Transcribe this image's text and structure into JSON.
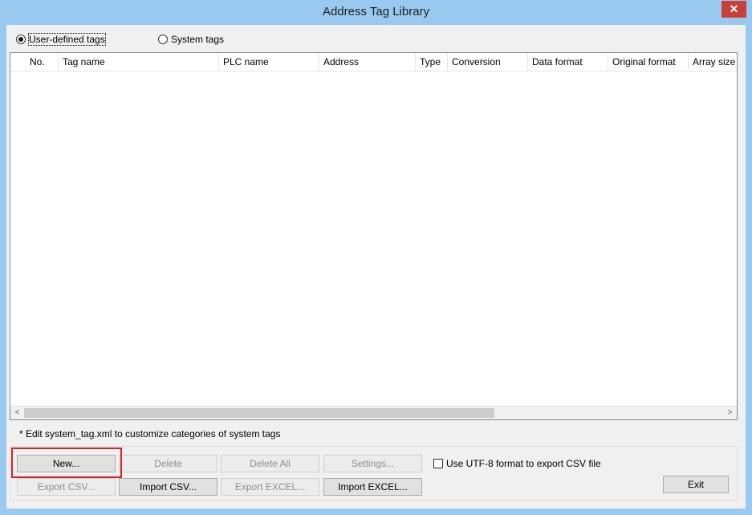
{
  "window": {
    "title": "Address Tag Library",
    "close_glyph": "✕"
  },
  "tag_type": {
    "options": [
      {
        "label": "User-defined tags",
        "selected": true
      },
      {
        "label": "System tags",
        "selected": false
      }
    ]
  },
  "table": {
    "columns": [
      "No.",
      "Tag name",
      "PLC name",
      "Address",
      "Type",
      "Conversion",
      "Data format",
      "Original format",
      "Array size"
    ],
    "rows": []
  },
  "scrollbar": {
    "left_arrow": "<",
    "right_arrow": ">"
  },
  "note": "* Edit system_tag.xml to customize categories of system tags",
  "buttons": {
    "new": "New...",
    "delete": "Delete",
    "delete_all": "Delete All",
    "settings": "Settings...",
    "export_csv": "Export CSV...",
    "import_csv": "Import CSV...",
    "export_excel": "Export EXCEL...",
    "import_excel": "Import EXCEL...",
    "exit": "Exit"
  },
  "utf8_option": {
    "label": "Use UTF-8 format to export CSV file",
    "checked": false
  },
  "colors": {
    "frame": "#99c9ef",
    "close": "#c7403a",
    "highlight": "#d42424"
  }
}
